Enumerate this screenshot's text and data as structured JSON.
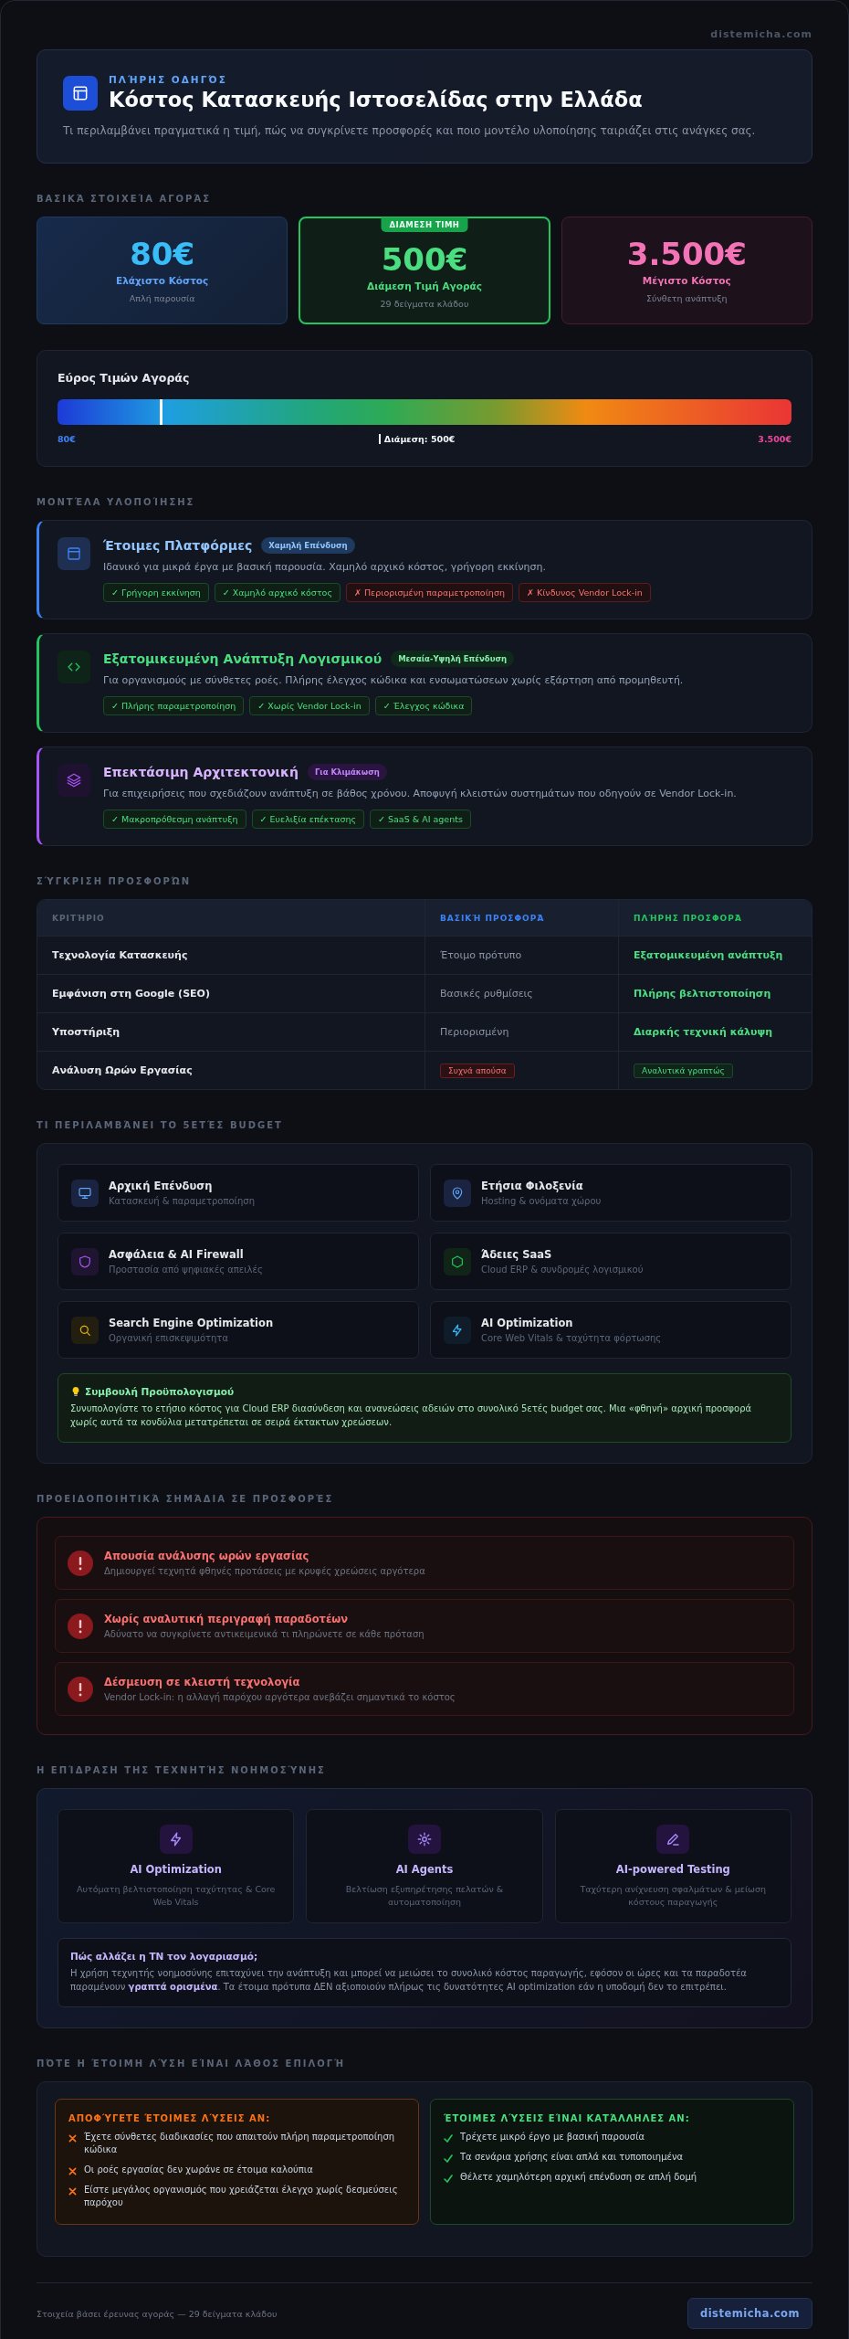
{
  "site": "distemicha.com",
  "header": {
    "eyebrow": "ΠΛΉΡΗΣ ΟΔΗΓΌΣ",
    "title": "Κόστος Κατασκευής Ιστοσελίδας στην Ελλάδα",
    "subtitle": "Τι περιλαμβάνει πραγματικά η τιμή, πώς να συγκρίνετε προσφορές και ποιο μοντέλο υλοποίησης ταιριάζει στις ανάγκες σας."
  },
  "market": {
    "heading": "ΒΑΣΙΚΆ ΣΤΟΙΧΕΊΑ ΑΓΟΡΆΣ",
    "stats": [
      {
        "kind": "low",
        "value": "80€",
        "label": "Ελάχιστο Κόστος",
        "note": "Απλή παρουσία"
      },
      {
        "kind": "median",
        "badge": "ΔΙΑΜΕΣΗ ΤΙΜΗ",
        "value": "500€",
        "label": "Διάμεση Τιμή Αγοράς",
        "note": "29 δείγματα κλάδου"
      },
      {
        "kind": "high",
        "value": "3.500€",
        "label": "Μέγιστο Κόστος",
        "note": "Σύνθετη ανάπτυξη"
      }
    ]
  },
  "range": {
    "title": "Εύρος Τιμών Αγοράς",
    "level": 0.14,
    "min_label": "80€",
    "median_label": "Διάμεση: 500€",
    "max_label": "3.500€"
  },
  "models": {
    "heading": "ΜΟΝΤΈΛΑ ΥΛΟΠΟΊΗΣΗΣ",
    "items": [
      {
        "kind": "platform",
        "title": "Έτοιμες Πλατφόρμες",
        "badge": "Χαμηλή Επένδυση",
        "description": "Ιδανικό για μικρά έργα με βασική παρουσία. Χαμηλό αρχικό κόστος, γρήγορη εκκίνηση.",
        "tags": [
          {
            "text": "✓ Γρήγορη εκκίνηση",
            "positive": true
          },
          {
            "text": "✓ Χαμηλό αρχικό κόστος",
            "positive": true
          },
          {
            "text": "✗ Περιορισμένη παραμετροποίηση",
            "positive": false
          },
          {
            "text": "✗ Κίνδυνος Vendor Lock-in",
            "positive": false
          }
        ]
      },
      {
        "kind": "custom",
        "title": "Εξατομικευμένη Ανάπτυξη Λογισμικού",
        "badge": "Μεσαία-Υψηλή Επένδυση",
        "description": "Για οργανισμούς με σύνθετες ροές. Πλήρης έλεγχος κώδικα και ενσωματώσεων χωρίς εξάρτηση από προμηθευτή.",
        "tags": [
          {
            "text": "✓ Πλήρης παραμετροποίηση",
            "positive": true
          },
          {
            "text": "✓ Χωρίς Vendor Lock-in",
            "positive": true
          },
          {
            "text": "✓ Έλεγχος κώδικα",
            "positive": true
          }
        ]
      },
      {
        "kind": "scalable",
        "title": "Επεκτάσιμη Αρχιτεκτονική",
        "badge": "Για Κλιμάκωση",
        "description": "Για επιχειρήσεις που σχεδιάζουν ανάπτυξη σε βάθος χρόνου. Αποφυγή κλειστών συστημάτων που οδηγούν σε Vendor Lock-in.",
        "tags": [
          {
            "text": "✓ Μακροπρόθεσμη ανάπτυξη",
            "positive": true
          },
          {
            "text": "✓ Ευελιξία επέκτασης",
            "positive": true
          },
          {
            "text": "✓ SaaS & AI agents",
            "positive": true
          }
        ]
      }
    ]
  },
  "comparison": {
    "heading": "ΣΎΓΚΡΙΣΗ ΠΡΟΣΦΟΡΏΝ",
    "columns": [
      "ΚΡΙΤΉΡΙΟ",
      "ΒΑΣΙΚΉ ΠΡΟΣΦΟΡΆ",
      "ΠΛΉΡΗΣ ΠΡΟΣΦΟΡΆ"
    ],
    "rows": [
      {
        "criterion": "Τεχνολογία Κατασκευής",
        "basic": {
          "kind": "plain",
          "text": "Έτοιμο πρότυπο"
        },
        "full": {
          "kind": "strong",
          "text": "Εξατομικευμένη ανάπτυξη"
        }
      },
      {
        "criterion": "Εμφάνιση στη Google (SEO)",
        "basic": {
          "kind": "plain",
          "text": "Βασικές ρυθμίσεις"
        },
        "full": {
          "kind": "strong",
          "text": "Πλήρης βελτιστοποίηση"
        }
      },
      {
        "criterion": "Υποστήριξη",
        "basic": {
          "kind": "plain",
          "text": "Περιορισμένη"
        },
        "full": {
          "kind": "strong",
          "text": "Διαρκής τεχνική κάλυψη"
        }
      },
      {
        "criterion": "Ανάλυση Ωρών Εργασίας",
        "basic": {
          "kind": "bad",
          "text": "Συχνά απούσα"
        },
        "full": {
          "kind": "good",
          "text": "Αναλυτικά γραπτώς"
        }
      }
    ]
  },
  "budget": {
    "heading": "ΤΙ ΠΕΡΙΛΑΜΒΆΝΕΙ ΤΟ 5ΕΤΈΣ BUDGET",
    "items": [
      {
        "kind": "monitor",
        "title": "Αρχική Επένδυση",
        "subtitle": "Κατασκευή & παραμετροποίηση"
      },
      {
        "kind": "pin",
        "title": "Ετήσια Φιλοξενία",
        "subtitle": "Hosting & ονόματα χώρου"
      },
      {
        "kind": "shield",
        "title": "Ασφάλεια & AI Firewall",
        "subtitle": "Προστασία από ψηφιακές απειλές"
      },
      {
        "kind": "hexagon",
        "title": "Άδειες SaaS",
        "subtitle": "Cloud ERP & συνδρομές λογισμικού"
      },
      {
        "kind": "search",
        "title": "Search Engine Optimization",
        "subtitle": "Οργανική επισκεψιμότητα"
      },
      {
        "kind": "bolt",
        "title": "AI Optimization",
        "subtitle": "Core Web Vitals & ταχύτητα φόρτωσης"
      }
    ],
    "tip": {
      "title": "Συμβουλή Προϋπολογισμού",
      "text": "Συνυπολογίστε το ετήσιο κόστος για Cloud ERP διασύνδεση και ανανεώσεις αδειών στο συνολικό 5ετές budget σας. Μια «φθηνή» αρχική προσφορά χωρίς αυτά τα κονδύλια μετατρέπεται σε σειρά έκτακτων χρεώσεων."
    }
  },
  "warnings": {
    "heading": "ΠΡΟΕΙΔΟΠΟΙΗΤΙΚΆ ΣΗΜΆΔΙΑ ΣΕ ΠΡΟΣΦΟΡΈΣ",
    "items": [
      {
        "title": "Απουσία ανάλυσης ωρών εργασίας",
        "text": "Δημιουργεί τεχνητά φθηνές προτάσεις με κρυφές χρεώσεις αργότερα"
      },
      {
        "title": "Χωρίς αναλυτική περιγραφή παραδοτέων",
        "text": "Αδύνατο να συγκρίνετε αντικειμενικά τι πληρώνετε σε κάθε πρόταση"
      },
      {
        "title": "Δέσμευση σε κλειστή τεχνολογία",
        "text": "Vendor Lock-in: η αλλαγή παρόχου αργότερα ανεβάζει σημαντικά το κόστος"
      }
    ]
  },
  "ai": {
    "heading": "Η ΕΠΊΔΡΑΣΗ ΤΗΣ ΤΕΧΝΗΤΉΣ ΝΟΗΜΟΣΎΝΗΣ",
    "cards": [
      {
        "kind": "bolt",
        "title": "AI Optimization",
        "text": "Αυτόματη βελτιστοποίηση ταχύτητας & Core Web Vitals"
      },
      {
        "kind": "sun",
        "title": "AI Agents",
        "text": "Βελτίωση εξυπηρέτησης πελατών & αυτοματοποίηση"
      },
      {
        "kind": "pen",
        "title": "AI-powered Testing",
        "text": "Ταχύτερη ανίχνευση σφαλμάτων & μείωση κόστους παραγωγής"
      }
    ],
    "note": {
      "title": "Πώς αλλάζει η ΤΝ τον λογαριασμό;",
      "text": "Η χρήση τεχνητής νοημοσύνης επιταχύνει την ανάπτυξη και μπορεί να μειώσει το συνολικό κόστος παραγωγής, εφόσον οι ώρες και τα παραδοτέα παραμένουν **γραπτά ορισμένα**. Τα έτοιμα πρότυπα ΔΕΝ αξιοποιούν πλήρως τις δυνατότητες AI optimization εάν η υποδομή δεν το επιτρέπει."
    }
  },
  "fit": {
    "heading": "ΠΌΤΕ Η ΈΤΟΙΜΗ ΛΎΣΗ ΕΊΝΑΙ ΛΆΘΟΣ ΕΠΙΛΟΓΉ",
    "panels": [
      {
        "kind": "avoid",
        "title": "ΑΠΟΦΎΓΕΤΕ ΈΤΟΙΜΕΣ ΛΎΣΕΙΣ ΑΝ:",
        "items": [
          "Έχετε σύνθετες διαδικασίες που απαιτούν πλήρη παραμετροποίηση κώδικα",
          "Οι ροές εργασίας δεν χωράνε σε έτοιμα καλούπια",
          "Είστε μεγάλος οργανισμός που χρειάζεται έλεγχο χωρίς δεσμεύσεις παρόχου"
        ]
      },
      {
        "kind": "suitable",
        "title": "ΈΤΟΙΜΕΣ ΛΎΣΕΙΣ ΕΊΝΑΙ ΚΑΤΆΛΛΗΛΕΣ ΑΝ:",
        "items": [
          "Τρέχετε μικρό έργο με βασική παρουσία",
          "Τα σενάρια χρήσης είναι απλά και τυποποιημένα",
          "Θέλετε χαμηλότερη αρχική επένδυση σε απλή δομή"
        ]
      }
    ]
  },
  "footer": {
    "source": "Στοιχεία βάσει έρευνας αγοράς — 29 δείγματα κλάδου",
    "brand": "distemicha.com"
  }
}
